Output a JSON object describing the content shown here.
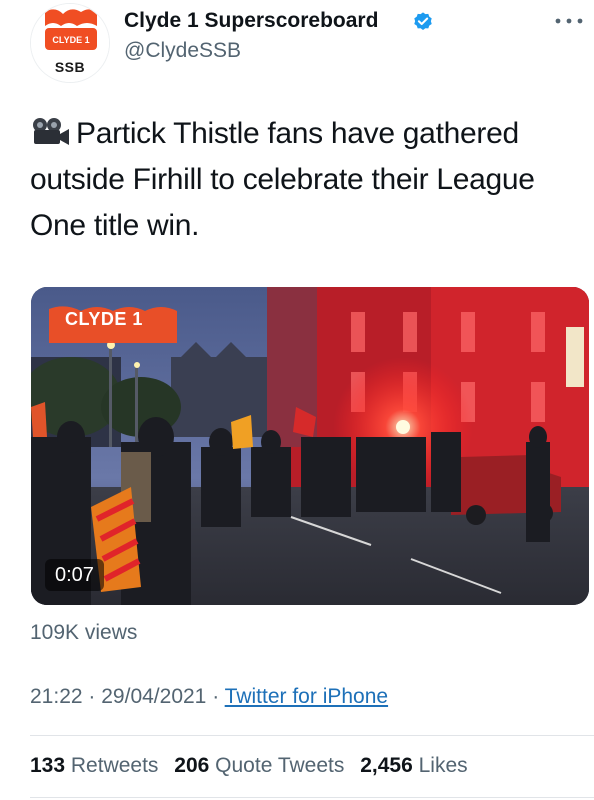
{
  "header": {
    "display_name": "Clyde 1 Superscoreboard",
    "handle": "@ClydeSSB",
    "avatar": {
      "brand_text": "CLYDE 1",
      "caption": "SSB",
      "brand_color": "#f04e23"
    },
    "verified": true,
    "more_icon": "more-horizontal-icon"
  },
  "tweet": {
    "emoji_icon": "movie-camera-icon",
    "text": "Partick Thistle fans have gathered outside Firhill to celebrate their League One title win."
  },
  "media": {
    "overlay_logo": "CLYDE 1",
    "duration": "0:07"
  },
  "views": "109K views",
  "meta": {
    "time": "21:22",
    "separator": "·",
    "date": "29/04/2021",
    "source": "Twitter for iPhone"
  },
  "stats": {
    "retweets_count": "133",
    "retweets_label": "Retweets",
    "quote_tweets_count": "206",
    "quote_tweets_label": "Quote Tweets",
    "likes_count": "2,456",
    "likes_label": "Likes"
  },
  "colors": {
    "text": "#0f1419",
    "secondary": "#536471",
    "link": "#1d70b8",
    "verified": "#1d9bf0",
    "flare": "#ff2a2a"
  }
}
